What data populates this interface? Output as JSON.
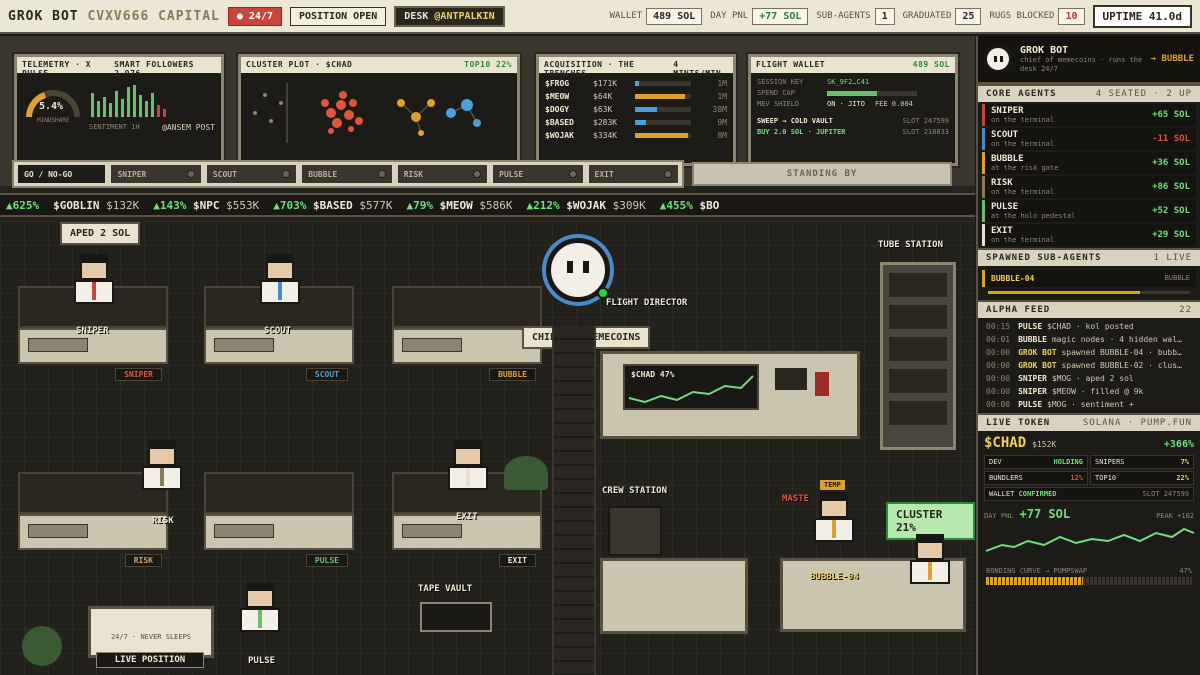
{
  "topbar": {
    "brand": "GROK BOT",
    "brand_sub": "CVXV666 CAPITAL",
    "live_badge": "24/7",
    "position_btn": "POSITION OPEN",
    "desk_label": "DESK",
    "desk_handle": "@ANTPALKIN",
    "wallet_label": "WALLET",
    "wallet_value": "489 SOL",
    "daypnl_label": "DAY PNL",
    "daypnl_value": "+77 SOL",
    "subagents_label": "SUB-AGENTS",
    "subagents_value": "1",
    "graduated_label": "GRADUATED",
    "graduated_value": "25",
    "rugs_label": "RUGS BLOCKED",
    "rugs_value": "10",
    "uptime": "UPTIME 41.0d"
  },
  "panels": {
    "telemetry": {
      "title": "TELEMETRY · X PULSE",
      "right": "SMART FOLLOWERS 2,976",
      "mindshare": "5.4%",
      "mindshare_label": "MINDSHARE",
      "sentiment": "SENTIMENT 1H",
      "handle": "@ANSEM POST"
    },
    "cluster": {
      "title": "CLUSTER PLOT · $CHAD",
      "right": "TOP10 22%"
    },
    "acquisition": {
      "title": "ACQUISITION · THE TRENCHES",
      "right": "4 MINTS/MIN",
      "rows": [
        {
          "sym": "$FROG",
          "mc": "$171K",
          "age": "1M",
          "fill": 0.08
        },
        {
          "sym": "$MEOW",
          "mc": "$64K",
          "age": "1M",
          "fill": 0.9
        },
        {
          "sym": "$DOGY",
          "mc": "$63K",
          "age": "38M",
          "fill": 0.4
        },
        {
          "sym": "$BASED",
          "mc": "$283K",
          "age": "9M",
          "fill": 0.2
        },
        {
          "sym": "$WOJAK",
          "mc": "$334K",
          "age": "8M",
          "fill": 0.95
        }
      ]
    },
    "flight": {
      "title": "FLIGHT WALLET",
      "right": "489 SOL",
      "session_key_label": "SESSION KEY",
      "session_key": "SK_9F2…C41",
      "spend_cap_label": "SPEND CAP",
      "spend_cap_fill": 0.55,
      "mev_label": "MEV SHIELD",
      "mev_value": "ON · JITO",
      "fee": "FEE 0.004",
      "sweep": "SWEEP → COLD VAULT",
      "sweep_slot": "SLOT 247599",
      "buy": "BUY 2.0 SOL · JUPITER",
      "buy_slot": "SLOT 218833"
    }
  },
  "controls": {
    "gonogo": "GO / NO-GO",
    "buttons": [
      "SNIPER",
      "SCOUT",
      "BUBBLE",
      "RISK",
      "PULSE",
      "EXIT"
    ],
    "standby": "STANDING BY"
  },
  "ticker": [
    {
      "pct": "▲625%",
      "sym": "",
      "mc": ""
    },
    {
      "pct": "",
      "sym": "$GOBLIN",
      "mc": "$132K"
    },
    {
      "pct": "▲143%",
      "sym": "$NPC",
      "mc": "$553K"
    },
    {
      "pct": "▲703%",
      "sym": "$BASED",
      "mc": "$577K"
    },
    {
      "pct": "▲79%",
      "sym": "$MEOW",
      "mc": "$586K"
    },
    {
      "pct": "▲212%",
      "sym": "$WOJAK",
      "mc": "$309K"
    },
    {
      "pct": "▲455%",
      "sym": "$BO",
      "mc": ""
    }
  ],
  "scene": {
    "aped": "APED 2 SOL",
    "flight_director": "FLIGHT DIRECTOR",
    "chief": "CHIEF OF MEMECOINS",
    "tube_station": "TUBE STATION",
    "crew_station": "CREW STATION",
    "tape_vault": "TAPE VAULT",
    "chad_chart": "$CHAD 47%",
    "cluster_tag": "CLUSTER 21%",
    "bubble04": "BUBBLE-04",
    "temp_tag": "TEMP",
    "master_tag": "MASTE",
    "never_sleeps": "24/7 · NEVER SLEEPS",
    "live_position": "LIVE POSITION",
    "desks": {
      "sniper": "SNIPER",
      "scout": "SCOUT",
      "bubble": "BUBBLE",
      "risk": "RISK",
      "pulse": "PULSE",
      "exit": "EXIT"
    },
    "agents": {
      "sniper": "SNIPER",
      "scout": "SCOUT",
      "risk": "RISK",
      "exit": "EXIT",
      "pulse": "PULSE"
    }
  },
  "side": {
    "grok_name": "GROK BOT",
    "grok_desc": "chief of memecoins · runs the desk 24/7",
    "grok_target": "→ BUBBLE",
    "core_title": "CORE AGENTS",
    "core_sub": "4 SEATED · 2 UP",
    "agents": [
      {
        "name": "SNIPER",
        "sub": "on the terminal",
        "pnl": "+65 SOL",
        "color": "#c9443a",
        "pos": true
      },
      {
        "name": "SCOUT",
        "sub": "on the terminal",
        "pnl": "-11 SOL",
        "color": "#4a8ac9",
        "pos": false
      },
      {
        "name": "BUBBLE",
        "sub": "at the risk gate",
        "pnl": "+36 SOL",
        "color": "#e0a030",
        "pos": true
      },
      {
        "name": "RISK",
        "sub": "on the terminal",
        "pnl": "+86 SOL",
        "color": "#8a7a5a",
        "pos": true
      },
      {
        "name": "PULSE",
        "sub": "at the holo pedestal",
        "pnl": "+52 SOL",
        "color": "#6ac06a",
        "pos": true
      },
      {
        "name": "EXIT",
        "sub": "on the terminal",
        "pnl": "+29 SOL",
        "color": "#e8e2cf",
        "pos": true
      }
    ],
    "spawned_title": "SPAWNED SUB-AGENTS",
    "spawned_sub": "1 LIVE",
    "spawned_name": "BUBBLE-04",
    "spawned_parent": "BUBBLE",
    "feed_title": "ALPHA FEED",
    "feed_count": "22",
    "feed": [
      {
        "t": "00:15",
        "who": "PULSE",
        "msg": "$CHAD · kol posted"
      },
      {
        "t": "00:01",
        "who": "BUBBLE",
        "msg": "magic nodes · 4 hidden wal…"
      },
      {
        "t": "00:00",
        "who": "GROK BOT",
        "msg": "spawned BUBBLE-04 · bubb…"
      },
      {
        "t": "00:00",
        "who": "GROK BOT",
        "msg": "spawned BUBBLE-02 · clus…"
      },
      {
        "t": "00:00",
        "who": "SNIPER",
        "msg": "$MOG · aped 2 sol"
      },
      {
        "t": "00:00",
        "who": "SNIPER",
        "msg": "$MEOW · filled @ 9k"
      },
      {
        "t": "00:00",
        "who": "PULSE",
        "msg": "$MOG · sentiment +"
      }
    ],
    "live_title": "LIVE TOKEN",
    "live_sub": "SOLANA · PUMP.FUN",
    "token": "$CHAD",
    "token_mc": "$152K",
    "token_pct": "+366%",
    "dev_label": "DEV",
    "dev_value": "HOLDING",
    "snipers_label": "SNIPERS",
    "snipers_value": "7%",
    "bundlers_label": "BUNDLERS",
    "bundlers_value": "12%",
    "top10_label": "TOP10",
    "top10_value": "22%",
    "wallet_label": "WALLET",
    "wallet_value": "CONFIRMED",
    "slot": "SLOT 247599",
    "daypnl_label": "DAY PNL",
    "daypnl_value": "+77 SOL",
    "peak": "PEAK +102",
    "bonding_label": "BONDING CURVE → PUMPSWAP",
    "bonding_value": "47%",
    "bonding_fill": 0.47
  }
}
